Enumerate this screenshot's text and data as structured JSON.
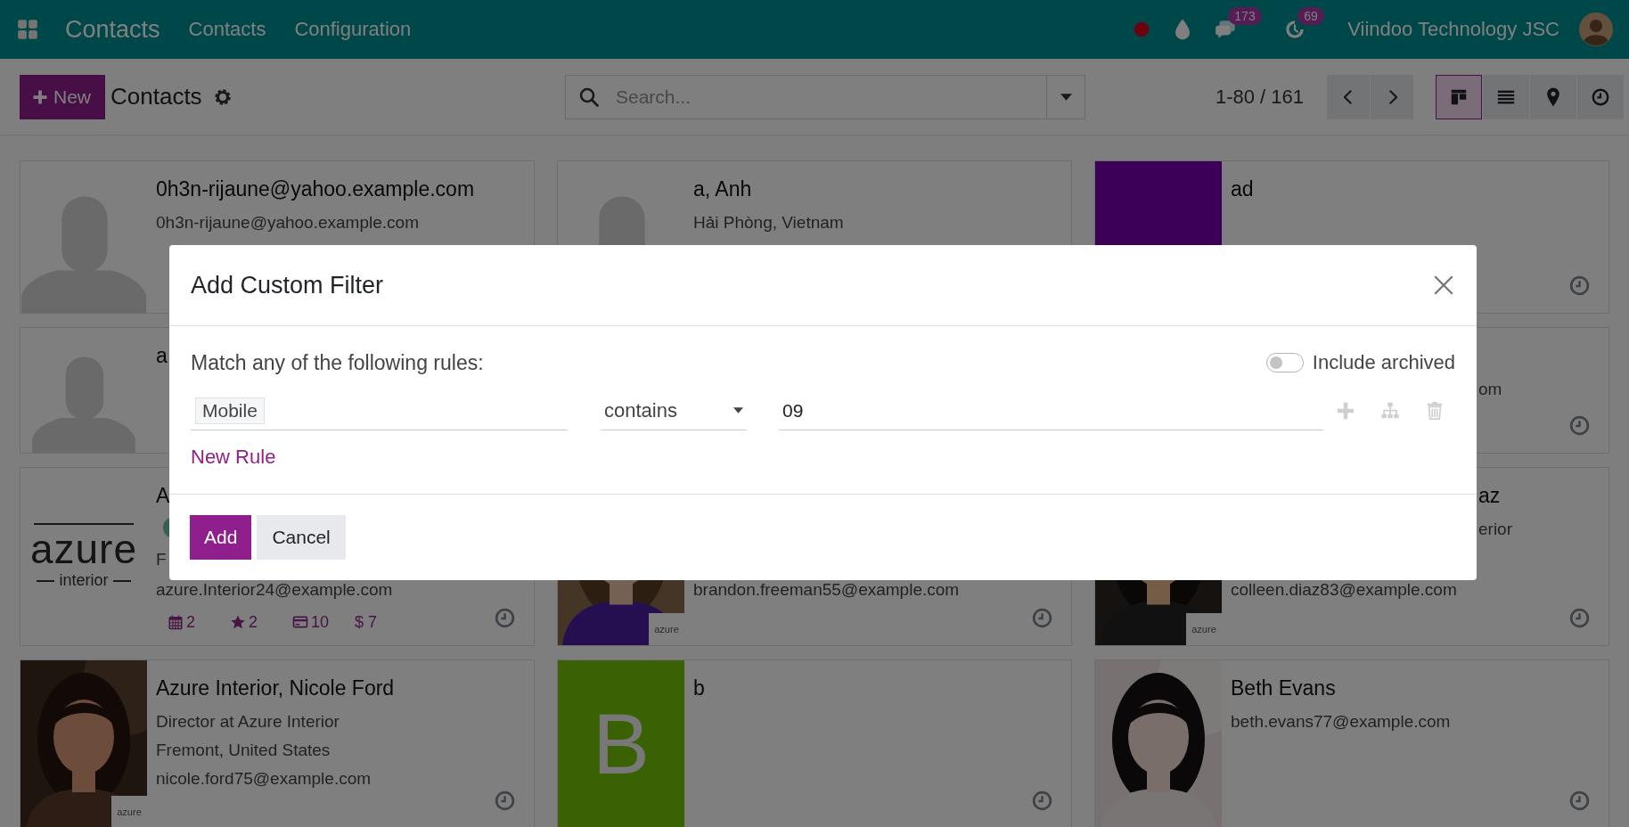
{
  "navbar": {
    "app_name": "Contacts",
    "menus": [
      "Contacts",
      "Configuration"
    ],
    "icons": [
      {
        "kind": "dot"
      },
      {
        "kind": "drop"
      },
      {
        "kind": "chat",
        "badge": "173"
      },
      {
        "kind": "activity",
        "badge": "69"
      }
    ],
    "company": "Viindoo Technology JSC"
  },
  "control_panel": {
    "new_button": "New",
    "title": "Contacts",
    "search": {
      "placeholder": "Search..."
    },
    "pager": "1-80 / 161",
    "views": [
      {
        "kind": "kanban",
        "selected": true
      },
      {
        "kind": "list",
        "selected": false
      },
      {
        "kind": "map",
        "selected": false
      },
      {
        "kind": "activity",
        "selected": false
      }
    ]
  },
  "kanban": {
    "rows": [
      [
        {
          "avatar": {
            "kind": "silhouette"
          },
          "name": "0h3n-rijaune@yahoo.example.com",
          "lines": [
            "0h3n-rijaune@yahoo.example.com"
          ]
        },
        {
          "avatar": {
            "kind": "silhouette"
          },
          "name": "a, Anh",
          "lines": [
            "Hải Phòng, Vietnam"
          ]
        },
        {
          "avatar": {
            "kind": "letter"
          },
          "name": "ad",
          "activity": true
        }
      ],
      [
        {
          "avatar": {
            "kind": "silhouette"
          },
          "name": "a"
        },
        null,
        {
          "lines": [
            "om"
          ],
          "activity": true,
          "clipped": true
        }
      ],
      [
        {
          "avatar": {
            "kind": "logo",
            "word": "azure",
            "subword": "interior"
          },
          "name": "A",
          "tags": [
            {
              "kind": "tag"
            }
          ],
          "lines": [
            "F"
          ],
          "bottom_lines": [
            "azure.Interior24@example.com"
          ],
          "stats": [
            {
              "value": "2"
            },
            {
              "value": "2"
            },
            {
              "value": "10"
            },
            {
              "value": "$ 7"
            }
          ],
          "activity": true
        },
        {
          "avatar": {
            "kind": "picture",
            "badge": "azure"
          },
          "bottom_lines": [
            "brandon.freeman55@example.com"
          ],
          "activity": true
        },
        {
          "avatar": {
            "kind": "picture",
            "badge": "azure"
          },
          "name": "az",
          "lines": [
            "erior"
          ],
          "bottom_lines": [
            "colleen.diaz83@example.com"
          ],
          "activity": true,
          "clipped": true
        }
      ],
      [
        {
          "avatar": {
            "kind": "picture",
            "badge": "azure"
          },
          "name": "Azure Interior, Nicole Ford",
          "lines": [
            "Director at Azure Interior",
            "Fremont, United States",
            "nicole.ford75@example.com"
          ],
          "activity": true
        },
        {
          "avatar": {
            "kind": "letter",
            "letter": "B"
          },
          "name": "b",
          "activity": true
        },
        {
          "avatar": {
            "kind": "picture"
          },
          "name": "Beth Evans",
          "lines": [
            "beth.evans77@example.com"
          ],
          "activity": true
        }
      ]
    ]
  },
  "dialog": {
    "title": "Add Custom Filter",
    "intro": "Match any of the following rules:",
    "include_archived": {
      "label": "Include archived",
      "on": false
    },
    "rules": [
      {
        "field": "Mobile",
        "operator": "contains",
        "value": "09"
      }
    ],
    "new_rule": "New Rule",
    "buttons": [
      {
        "label": "Add",
        "kind": "primary"
      },
      {
        "label": "Cancel",
        "kind": "secondary"
      }
    ]
  }
}
